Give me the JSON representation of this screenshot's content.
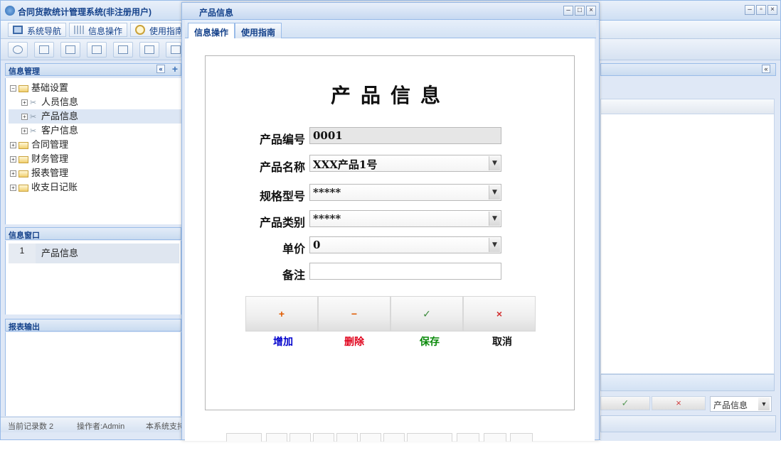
{
  "app": {
    "title": "合同货款统计管理系统(非注册用户)",
    "nav_tabs": [
      "系统导航",
      "信息操作",
      "使用指南"
    ]
  },
  "left_panel": {
    "header": "信息管理",
    "tree": [
      {
        "label": "基础设置",
        "level": 0,
        "expanded": true
      },
      {
        "label": "人员信息",
        "level": 1
      },
      {
        "label": "产品信息",
        "level": 1,
        "selected": true
      },
      {
        "label": "客户信息",
        "level": 1
      },
      {
        "label": "合同管理",
        "level": 0
      },
      {
        "label": "财务管理",
        "level": 0
      },
      {
        "label": "报表管理",
        "level": 0
      },
      {
        "label": "收支日记账",
        "level": 0
      }
    ]
  },
  "info_window": {
    "header": "信息窗口",
    "rows": [
      {
        "num": "1",
        "label": "产品信息"
      }
    ]
  },
  "report_output": {
    "header": "报表输出"
  },
  "status_bar": {
    "record_count": "当前记录数 2",
    "operator": "操作者:Admin",
    "support": "本系统支持"
  },
  "right_panel": {
    "select_value": "产品信息"
  },
  "dialog": {
    "title": "产品信息",
    "tabs": [
      "信息操作",
      "使用指南"
    ],
    "form_title": "产品信息",
    "fields": {
      "code": {
        "label": "产品编号",
        "value": "0001"
      },
      "name": {
        "label": "产品名称",
        "value": "XXX产品1号"
      },
      "spec": {
        "label": "规格型号",
        "value": "*****"
      },
      "category": {
        "label": "产品类别",
        "value": "*****"
      },
      "price": {
        "label": "单价",
        "value": "0"
      },
      "note": {
        "label": "备注",
        "value": ""
      }
    },
    "actions": [
      {
        "label": "增加",
        "symbol": "+",
        "color": "#0000cc",
        "symbol_color": "#e05a00"
      },
      {
        "label": "删除",
        "symbol": "−",
        "color": "#e0001a",
        "symbol_color": "#e05a00"
      },
      {
        "label": "保存",
        "symbol": "✓",
        "color": "#0a8a0a",
        "symbol_color": "#3a8a3a"
      },
      {
        "label": "取消",
        "symbol": "×",
        "color": "#111111",
        "symbol_color": "#d23030"
      }
    ]
  }
}
